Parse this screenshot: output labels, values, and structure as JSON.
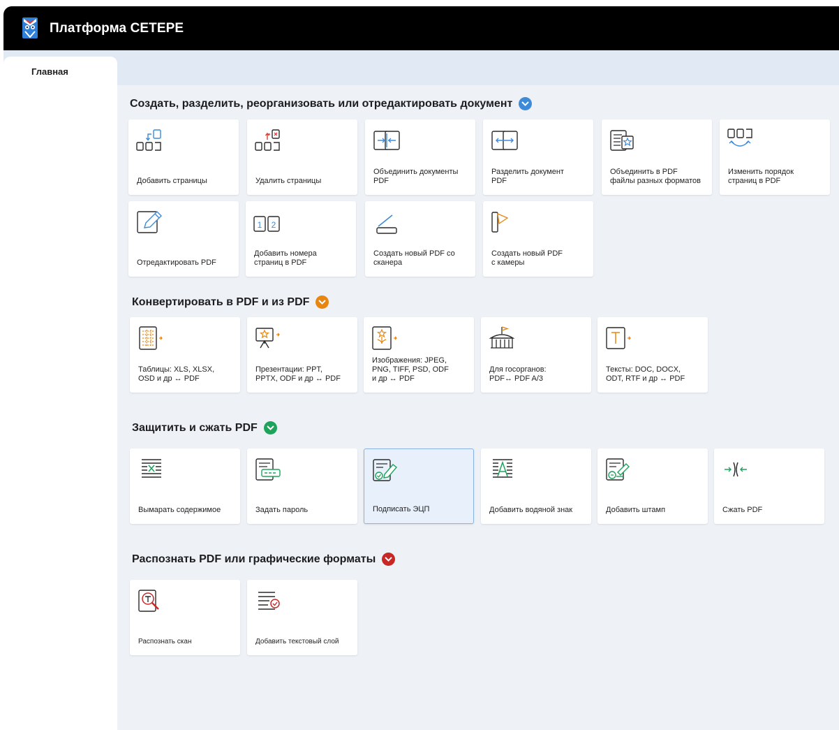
{
  "app": {
    "title": "Платформа СЕТЕРЕ"
  },
  "tabs": [
    {
      "label": "Главная"
    }
  ],
  "colors": {
    "blue": "#3d8bd8",
    "orange": "#e8860f",
    "green": "#1ea35b",
    "red": "#c62828"
  },
  "sections": [
    {
      "title": "Создать, разделить, реорганизовать или отредактировать документ",
      "cards": [
        {
          "label": "Добавить страницы",
          "icon": "add-pages-icon"
        },
        {
          "label": "Удалить страницы",
          "icon": "delete-pages-icon"
        },
        {
          "label": "Объединить документы\nPDF",
          "icon": "merge-documents-icon"
        },
        {
          "label": "Разделить документ\nPDF",
          "icon": "split-document-icon"
        },
        {
          "label": "Объединить в PDF\nфайлы разных форматов",
          "icon": "merge-formats-icon"
        },
        {
          "label": "Изменить порядок\nстраниц в PDF",
          "icon": "reorder-pages-icon"
        },
        {
          "label": "Отредактировать PDF",
          "icon": "edit-pdf-icon"
        },
        {
          "label": "Добавить номера\nстраниц в PDF",
          "icon": "page-numbers-icon"
        },
        {
          "label": "Создать новый PDF со\nсканера",
          "icon": "scanner-icon"
        },
        {
          "label": "Создать новый PDF\nс камеры",
          "icon": "camera-icon"
        }
      ]
    },
    {
      "title": "Конвертировать в PDF и из PDF",
      "cards": [
        {
          "label": "Таблицы: XLS, XLSX,\nOSD и др ↔ PDF",
          "icon": "spreadsheet-icon"
        },
        {
          "label": "Презентации: PPT,\nPPTX, ODF и др ↔ PDF",
          "icon": "presentation-icon"
        },
        {
          "label": "Изображения: JPEG,\nPNG, TIFF, PSD, ODF\nи др ↔ PDF",
          "icon": "image-icon"
        },
        {
          "label": "Для госорганов:\nPDF↔ PDF A/3",
          "icon": "government-icon"
        },
        {
          "label": "Тексты: DOC, DOCX,\nODT, RTF и др ↔ PDF",
          "icon": "text-document-icon"
        }
      ]
    },
    {
      "title": "Защитить и сжать PDF",
      "cards": [
        {
          "label": "Вымарать содержимое",
          "icon": "redact-icon"
        },
        {
          "label": "Задать пароль",
          "icon": "password-icon"
        },
        {
          "label": "Подписать ЭЦП",
          "icon": "digital-signature-icon",
          "selected": true
        },
        {
          "label": "Добавить водяной знак",
          "icon": "watermark-icon"
        },
        {
          "label": "Добавить штамп",
          "icon": "stamp-icon"
        },
        {
          "label": "Сжать PDF",
          "icon": "compress-icon"
        }
      ]
    },
    {
      "title": "Распознать PDF или графические форматы",
      "cards": [
        {
          "label": "Распознать скан",
          "icon": "recognize-scan-icon"
        },
        {
          "label": "Добавить текстовый слой",
          "icon": "text-layer-icon"
        }
      ]
    }
  ]
}
